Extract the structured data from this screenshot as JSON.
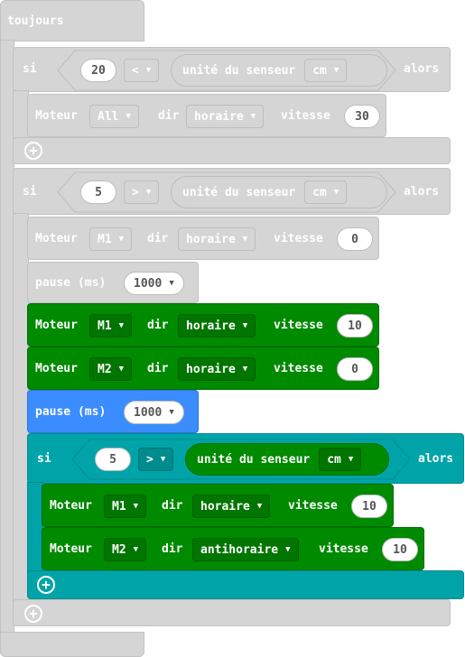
{
  "forever": {
    "label": "toujours"
  },
  "if1": {
    "si": "si",
    "num": "20",
    "op": "<",
    "sensor": "unité du senseur",
    "unit": "cm",
    "alors": "alors",
    "motor": {
      "label": "Moteur",
      "which": "All",
      "dir": "dir",
      "dirval": "horaire",
      "speed": "vitesse",
      "speedval": "30"
    }
  },
  "if2": {
    "si": "si",
    "num": "5",
    "op": ">",
    "sensor": "unité du senseur",
    "unit": "cm",
    "alors": "alors",
    "motor": {
      "label": "Moteur",
      "which": "M1",
      "dir": "dir",
      "dirval": "horaire",
      "speed": "vitesse",
      "speedval": "0"
    },
    "pause": {
      "label": "pause (ms)",
      "value": "1000"
    },
    "green1": {
      "label": "Moteur",
      "which": "M1",
      "dir": "dir",
      "dirval": "horaire",
      "speed": "vitesse",
      "speedval": "10"
    },
    "green2": {
      "label": "Moteur",
      "which": "M2",
      "dir": "dir",
      "dirval": "horaire",
      "speed": "vitesse",
      "speedval": "0"
    },
    "bluePause": {
      "label": "pause (ms)",
      "value": "1000"
    }
  },
  "if3": {
    "si": "si",
    "num": "5",
    "op": ">",
    "sensor": "unité du senseur",
    "unit": "cm",
    "alors": "alors",
    "m1": {
      "label": "Moteur",
      "which": "M1",
      "dir": "dir",
      "dirval": "horaire",
      "speed": "vitesse",
      "speedval": "10"
    },
    "m2": {
      "label": "Moteur",
      "which": "M2",
      "dir": "dir",
      "dirval": "antihoraire",
      "speed": "vitesse",
      "speedval": "10"
    }
  },
  "plusIcon": "+",
  "colors": {
    "gray": "#d5d5d5",
    "green": "#008a00",
    "blue": "#3b8cff",
    "teal": "#00a4a8"
  }
}
